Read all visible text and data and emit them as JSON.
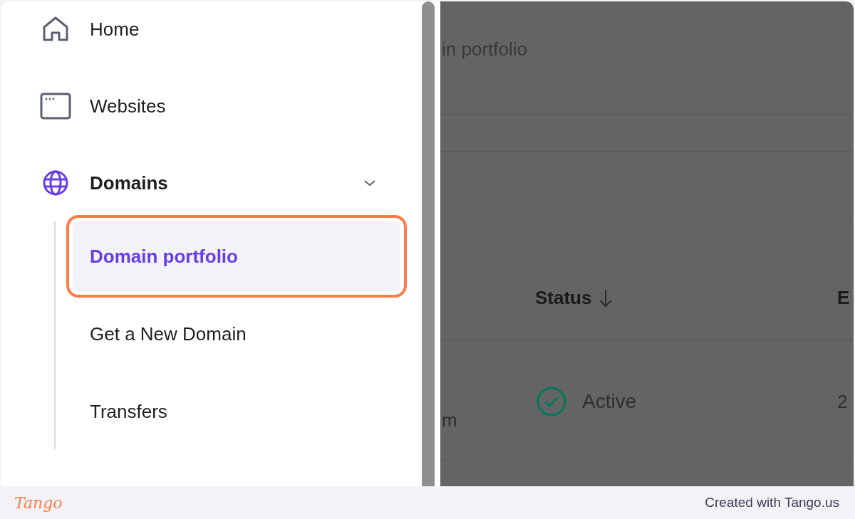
{
  "sidebar": {
    "items": [
      {
        "label": "Home",
        "kind": "home"
      },
      {
        "label": "Websites",
        "kind": "window"
      },
      {
        "label": "Domains",
        "kind": "globe",
        "expanded": true,
        "children": [
          {
            "label": "Domain portfolio",
            "selected": true
          },
          {
            "label": "Get a New Domain",
            "selected": false
          },
          {
            "label": "Transfers",
            "selected": false
          }
        ]
      }
    ]
  },
  "background_page": {
    "title": "in portfolio",
    "columns": [
      {
        "label": "Status",
        "sorted": true
      },
      {
        "label": "E"
      }
    ],
    "rows": [
      {
        "column_1": "m",
        "status": "Active",
        "column_3": "2"
      }
    ]
  },
  "footer": {
    "brand": "Tango",
    "caption": "Created with Tango.us"
  }
}
